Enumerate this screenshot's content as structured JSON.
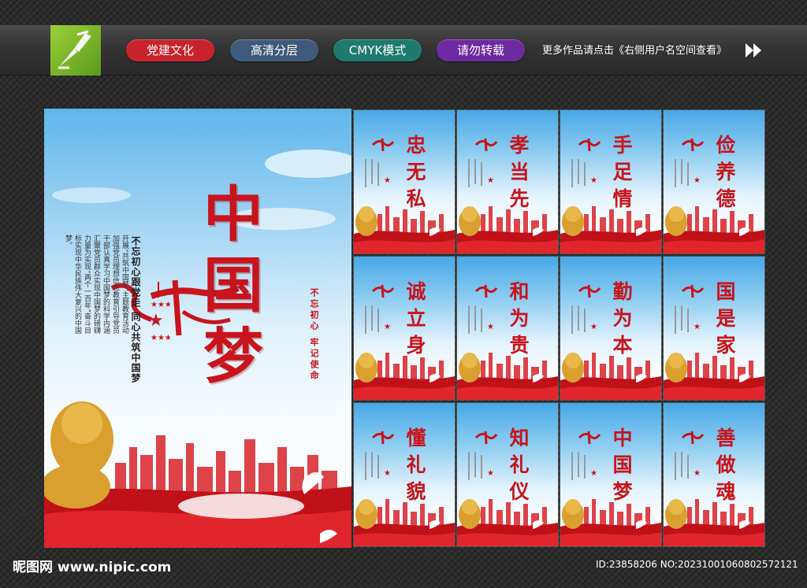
{
  "header": {
    "tags": [
      {
        "label": "党建文化",
        "color": "#c8232c"
      },
      {
        "label": "高清分层",
        "color": "#3f5a7a"
      },
      {
        "label": "CMYK模式",
        "color": "#1f7a6e"
      },
      {
        "label": "请勿转载",
        "color": "#6e2aa0"
      }
    ],
    "promo_text": "更多作品请点击《右侧用户名空间查看》"
  },
  "main_poster": {
    "title": "中国梦",
    "slogan": "不忘初心跟党走 同心共筑中国梦",
    "body": "开展“共筑中国梦”主题教育活动加强党员理想信念教育引导党员干部认真学习中国梦的科学内涵汇聚党员群众实现中国梦的磅礴力量为实现“两个一百年”奋斗目标实现中华民族伟大复兴的中国梦。",
    "seal_text": "不忘初心 牢记使命",
    "accent_color": "#c8141c"
  },
  "panels": [
    {
      "title": "忠无私"
    },
    {
      "title": "孝当先"
    },
    {
      "title": "手足情"
    },
    {
      "title": "俭养德"
    },
    {
      "title": "诚立身"
    },
    {
      "title": "和为贵"
    },
    {
      "title": "勤为本"
    },
    {
      "title": "国是家"
    },
    {
      "title": "懂礼貌"
    },
    {
      "title": "知礼仪"
    },
    {
      "title": "中国梦"
    },
    {
      "title": "善做魂"
    }
  ],
  "footer": {
    "site": "昵图网 www.nipic.com",
    "id_text": "ID:23858206 NO:20231001060802572121"
  }
}
